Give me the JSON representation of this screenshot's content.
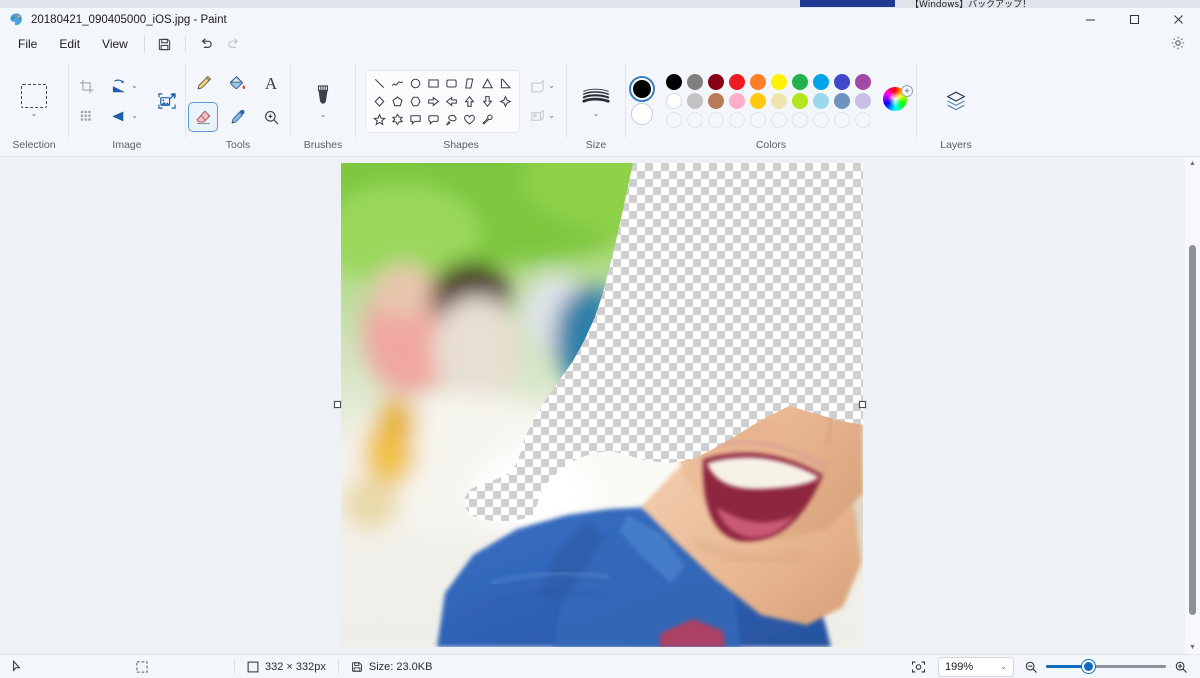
{
  "background_window": {
    "text": "【Windows】バックアップ！"
  },
  "titlebar": {
    "app_icon": "paint-palette-icon",
    "title": "20180421_090405000_iOS.jpg - Paint",
    "minimize_label": "—",
    "maximize_label": "□",
    "close_label": "✕"
  },
  "menubar": {
    "items": [
      {
        "label": "File",
        "name": "menu-file"
      },
      {
        "label": "Edit",
        "name": "menu-edit"
      },
      {
        "label": "View",
        "name": "menu-view"
      }
    ],
    "save_icon": "save-icon",
    "undo_icon": "undo-icon",
    "redo_icon": "redo-icon",
    "settings_icon": "gear-icon"
  },
  "ribbon": {
    "groups": [
      {
        "label": "Selection",
        "name": "group-selection"
      },
      {
        "label": "Image",
        "name": "group-image"
      },
      {
        "label": "Tools",
        "name": "group-tools"
      },
      {
        "label": "Brushes",
        "name": "group-brushes"
      },
      {
        "label": "Shapes",
        "name": "group-shapes"
      },
      {
        "label": "Size",
        "name": "group-size"
      },
      {
        "label": "Colors",
        "name": "group-colors"
      },
      {
        "label": "Layers",
        "name": "group-layers"
      }
    ],
    "selection": {
      "icon": "rectangular-selection-icon",
      "chevron": "⌄"
    },
    "image": {
      "crop_icon": "crop-icon",
      "resize_icon": "resize-skew-icon",
      "rotate_icon": "rotate-icon",
      "flip_icon": "flip-icon",
      "image_resize_icon": "image-resize-icon"
    },
    "tools": [
      {
        "name": "pencil-tool",
        "icon": "pencil-icon",
        "selected": false
      },
      {
        "name": "fill-tool",
        "icon": "paint-bucket-icon",
        "selected": false
      },
      {
        "name": "text-tool",
        "icon": "text-a-icon",
        "selected": false
      },
      {
        "name": "eraser-tool",
        "icon": "eraser-icon",
        "selected": true
      },
      {
        "name": "color-picker-tool",
        "icon": "eyedropper-icon",
        "selected": false
      },
      {
        "name": "magnifier-tool",
        "icon": "magnifier-icon",
        "selected": false
      }
    ],
    "brushes": {
      "icon": "brush-icon",
      "chevron": "⌄"
    },
    "shapes": [
      "line",
      "curve",
      "oval",
      "rectangle",
      "rounded-rectangle",
      "right-triangle",
      "triangle",
      "diagonal-triangle",
      "diamond",
      "pentagon",
      "hexagon",
      "right-arrow",
      "left-arrow",
      "up-arrow",
      "down-arrow",
      "four-point-star",
      "five-point-star",
      "six-point-star",
      "rectangular-callout",
      "rounded-callout",
      "cloud-callout",
      "heart",
      "lightning"
    ],
    "shape_outline": {
      "name": "shape-outline-style",
      "icon": "outline-icon",
      "disabled": true
    },
    "shape_fill": {
      "name": "shape-fill-style",
      "icon": "fill-icon",
      "disabled": true
    },
    "size": {
      "icon": "brush-size-icon",
      "chevron": "⌄"
    },
    "colors": {
      "primary": "#000000",
      "secondary": "#ffffff",
      "row1": [
        "#000000",
        "#7f7f7f",
        "#880015",
        "#ed1c24",
        "#ff7f27",
        "#fff200",
        "#22b14c",
        "#00a2e8",
        "#3f48cc",
        "#a349a4"
      ],
      "row2": [
        "#ffffff",
        "#c3c3c3",
        "#b97a57",
        "#ffaec9",
        "#ffc90e",
        "#efe4b0",
        "#b5e61d",
        "#99d9ea",
        "#7092be",
        "#c8bfe7"
      ],
      "row3_empty_count": 10,
      "wheel": {
        "name": "color-wheel-picker",
        "icon": "color-wheel-icon",
        "badge": "+"
      }
    },
    "layers": {
      "icon": "layers-icon"
    }
  },
  "canvas": {
    "image_name": "photo-canvas",
    "transparent_region": "checkerboard-erased-area",
    "handles": [
      "handle-left-middle",
      "handle-right-middle"
    ]
  },
  "statusbar": {
    "cursor_icon": "cursor-arrow-icon",
    "selection_icon": "selection-icon",
    "dimensions_icon": "dimensions-icon",
    "dimensions": "332 × 332px",
    "filesize_icon": "save-disk-icon",
    "filesize": "Size: 23.0KB",
    "fit_icon": "fit-to-window-icon",
    "zoom_value": "199%",
    "zoom_chevron": "⌄",
    "zoom_out_icon": "zoom-out-icon",
    "zoom_in_icon": "zoom-in-icon"
  },
  "scrollbar": {
    "up_arrow": "▲",
    "down_arrow": "▼"
  }
}
